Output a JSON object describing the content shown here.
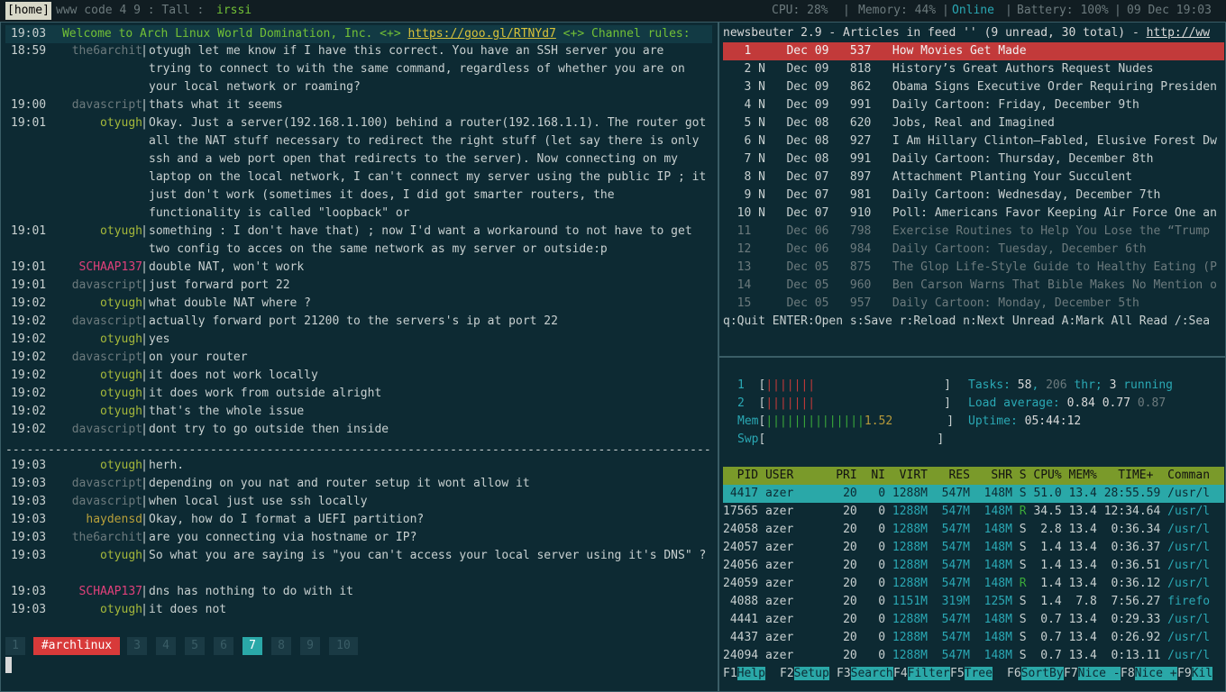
{
  "topbar": {
    "session": "[home]",
    "windows": "www code 4 9 : Tall : ",
    "app": "irssi",
    "cpu_label": "CPU: 28%",
    "mem_label": "Memory: 44%",
    "online": "Online",
    "battery": "Battery: 100%",
    "date": "09 Dec 19:03",
    "sep": "|"
  },
  "irssi": {
    "welcome": {
      "time": "19:03",
      "text": "Welcome to Arch Linux World Domination, Inc. <+> ",
      "link": "https://goo.gl/RTNYd7",
      "tail": " <+> Channel rules:"
    },
    "messages": [
      {
        "time": "18:59",
        "nick": "the6archit",
        "cls": "c-the6",
        "text": "otyugh let me know if I have this correct. You have an SSH server you are trying to connect to with the same command, regardless of whether you are on your local network or roaming?"
      },
      {
        "time": "19:00",
        "nick": "davascript",
        "cls": "c-dav",
        "text": "thats what it seems"
      },
      {
        "time": "19:01",
        "nick": "otyugh",
        "cls": "c-oty",
        "text": "Okay. Just a server(192.168.1.100) behind a router(192.168.1.1). The router got all the NAT stuff necessary to redirect the right stuff (let say there is only ssh and a web port open that redirects to the server). Now connecting on my laptop on the local network, I can't connect my server using the public IP ; it just don't work (sometimes it does, I did got smarter routers, the functionality is called \"loopback\" or"
      },
      {
        "time": "19:01",
        "nick": "otyugh",
        "cls": "c-oty",
        "text": "something : I don't have that) ; now I'd want a workaround to not have to get two config to acces on the same network as my server or outside:p"
      },
      {
        "time": "19:01",
        "nick": "SCHAAP137",
        "cls": "c-sch",
        "text": "double NAT, won't work"
      },
      {
        "time": "19:01",
        "nick": "davascript",
        "cls": "c-dav",
        "text": "just forward port 22"
      },
      {
        "time": "19:02",
        "nick": "otyugh",
        "cls": "c-oty",
        "text": "what double NAT where ?"
      },
      {
        "time": "19:02",
        "nick": "davascript",
        "cls": "c-dav",
        "text": "actually forward port 21200 to the servers's ip at port 22"
      },
      {
        "time": "19:02",
        "nick": "otyugh",
        "cls": "c-oty",
        "text": "yes"
      },
      {
        "time": "19:02",
        "nick": "davascript",
        "cls": "c-dav",
        "text": "on your router"
      },
      {
        "time": "19:02",
        "nick": "otyugh",
        "cls": "c-oty",
        "text": "it does not work locally"
      },
      {
        "time": "19:02",
        "nick": "otyugh",
        "cls": "c-oty",
        "text": "it does work from outside alright"
      },
      {
        "time": "19:02",
        "nick": "otyugh",
        "cls": "c-oty",
        "text": "that's the whole issue"
      },
      {
        "time": "19:02",
        "nick": "davascript",
        "cls": "c-dav",
        "text": "dont try to go outside then inside"
      }
    ],
    "divider": "--------------------------------------------------------------------------------------------------------",
    "messages2": [
      {
        "time": "19:03",
        "nick": "otyugh",
        "cls": "c-oty",
        "text": "herh."
      },
      {
        "time": "19:03",
        "nick": "davascript",
        "cls": "c-dav",
        "text": "depending on you nat and router setup it wont allow it"
      },
      {
        "time": "19:03",
        "nick": "davascript",
        "cls": "c-dav",
        "text": "when local just use ssh locally"
      },
      {
        "time": "19:03",
        "nick": "haydensd",
        "cls": "c-hay",
        "text": "Okay, how do I format a UEFI partition?"
      },
      {
        "time": "19:03",
        "nick": "the6archit",
        "cls": "c-the6",
        "text": "are you connecting via hostname or IP?"
      },
      {
        "time": "19:03",
        "nick": "otyugh",
        "cls": "c-oty",
        "text": "So what you are saying is \"you can't access your local server using it's DNS\" ?"
      },
      {
        "time": "19:03",
        "nick": "SCHAAP137",
        "cls": "c-sch",
        "text": "dns has nothing to do with it"
      },
      {
        "time": "19:03",
        "nick": "otyugh",
        "cls": "c-oty",
        "text": "it does not"
      }
    ],
    "tabs": [
      "1",
      "#archlinux",
      "3",
      "4",
      "5",
      "6",
      "7",
      "8",
      "9",
      "10"
    ]
  },
  "newsbeuter": {
    "title_text": "newsbeuter 2.9 - Articles in feed '' (9 unread, 30 total) - ",
    "title_link": "http://ww",
    "articles": [
      {
        "n": "1",
        "flag": " ",
        "date": "Dec 09",
        "size": "537",
        "title": "How Movies Get Made",
        "state": "sel"
      },
      {
        "n": "2",
        "flag": "N",
        "date": "Dec 09",
        "size": "818",
        "title": "History’s Great Authors Request Nudes",
        "state": "unread"
      },
      {
        "n": "3",
        "flag": "N",
        "date": "Dec 09",
        "size": "862",
        "title": "Obama Signs Executive Order Requiring Presiden",
        "state": "unread"
      },
      {
        "n": "4",
        "flag": "N",
        "date": "Dec 09",
        "size": "991",
        "title": "Daily Cartoon: Friday, December 9th",
        "state": "unread"
      },
      {
        "n": "5",
        "flag": "N",
        "date": "Dec 08",
        "size": "620",
        "title": "Jobs, Real and Imagined",
        "state": "unread"
      },
      {
        "n": "6",
        "flag": "N",
        "date": "Dec 08",
        "size": "927",
        "title": "I Am Hillary Clinton—Fabled, Elusive Forest Dw",
        "state": "unread"
      },
      {
        "n": "7",
        "flag": "N",
        "date": "Dec 08",
        "size": "991",
        "title": "Daily Cartoon: Thursday, December 8th",
        "state": "unread"
      },
      {
        "n": "8",
        "flag": "N",
        "date": "Dec 07",
        "size": "897",
        "title": "Attachment Planting Your Succulent",
        "state": "unread"
      },
      {
        "n": "9",
        "flag": "N",
        "date": "Dec 07",
        "size": "981",
        "title": "Daily Cartoon: Wednesday, December 7th",
        "state": "unread"
      },
      {
        "n": "10",
        "flag": "N",
        "date": "Dec 07",
        "size": "910",
        "title": "Poll: Americans Favor Keeping Air Force One an",
        "state": "unread"
      },
      {
        "n": "11",
        "flag": " ",
        "date": "Dec 06",
        "size": "798",
        "title": "Exercise Routines to Help You Lose the “Trump",
        "state": "read"
      },
      {
        "n": "12",
        "flag": " ",
        "date": "Dec 06",
        "size": "984",
        "title": "Daily Cartoon: Tuesday, December 6th",
        "state": "read"
      },
      {
        "n": "13",
        "flag": " ",
        "date": "Dec 05",
        "size": "875",
        "title": "The Glop Life-Style Guide to Healthy Eating (P",
        "state": "read"
      },
      {
        "n": "14",
        "flag": " ",
        "date": "Dec 05",
        "size": "960",
        "title": "Ben Carson Warns That Bible Makes No Mention o",
        "state": "read"
      },
      {
        "n": "15",
        "flag": " ",
        "date": "Dec 05",
        "size": "957",
        "title": "Daily Cartoon: Monday, December 5th",
        "state": "read"
      }
    ],
    "help": "q:Quit ENTER:Open s:Save r:Reload n:Next Unread A:Mark All Read /:Sea"
  },
  "htop": {
    "cpu1_label": "1",
    "cpu1_bar": "|||||||",
    "cpu2_label": "2",
    "cpu2_bar": "|||||||",
    "mem_label": "Mem",
    "mem_bar": "||||||||||||||",
    "mem_value": "1.52",
    "swp_label": "Swp",
    "tasks_label": "Tasks: ",
    "tasks": "58",
    "thr": "206",
    "thr_label": " thr; ",
    "running": "3",
    "running_label": " running",
    "load_label": "Load average: ",
    "load1": "0.84",
    "load5": "0.77",
    "load15": "0.87",
    "uptime_label": "Uptime: ",
    "uptime": "05:44:12",
    "header": "  PID USER      PRI  NI  VIRT   RES   SHR S CPU% MEM%   TIME+  Comman",
    "processes": [
      {
        "pid": "4417",
        "user": "azer",
        "pri": "20",
        "ni": "0",
        "virt": "1288M",
        "res": "547M",
        "shr": "148M",
        "s": "S",
        "cpu": "51.0",
        "mem": "13.4",
        "time": "28:55.59",
        "cmd": "/usr/l"
      },
      {
        "pid": "17565",
        "user": "azer",
        "pri": "20",
        "ni": "0",
        "virt": "1288M",
        "res": "547M",
        "shr": "148M",
        "s": "R",
        "cpu": "34.5",
        "mem": "13.4",
        "time": "12:34.64",
        "cmd": "/usr/l"
      },
      {
        "pid": "24058",
        "user": "azer",
        "pri": "20",
        "ni": "0",
        "virt": "1288M",
        "res": "547M",
        "shr": "148M",
        "s": "S",
        "cpu": "2.8",
        "mem": "13.4",
        "time": "0:36.34",
        "cmd": "/usr/l"
      },
      {
        "pid": "24057",
        "user": "azer",
        "pri": "20",
        "ni": "0",
        "virt": "1288M",
        "res": "547M",
        "shr": "148M",
        "s": "S",
        "cpu": "1.4",
        "mem": "13.4",
        "time": "0:36.37",
        "cmd": "/usr/l"
      },
      {
        "pid": "24056",
        "user": "azer",
        "pri": "20",
        "ni": "0",
        "virt": "1288M",
        "res": "547M",
        "shr": "148M",
        "s": "S",
        "cpu": "1.4",
        "mem": "13.4",
        "time": "0:36.51",
        "cmd": "/usr/l"
      },
      {
        "pid": "24059",
        "user": "azer",
        "pri": "20",
        "ni": "0",
        "virt": "1288M",
        "res": "547M",
        "shr": "148M",
        "s": "R",
        "cpu": "1.4",
        "mem": "13.4",
        "time": "0:36.12",
        "cmd": "/usr/l"
      },
      {
        "pid": "4088",
        "user": "azer",
        "pri": "20",
        "ni": "0",
        "virt": "1151M",
        "res": "319M",
        "shr": "125M",
        "s": "S",
        "cpu": "1.4",
        "mem": "7.8",
        "time": "7:56.27",
        "cmd": "firefo"
      },
      {
        "pid": "4441",
        "user": "azer",
        "pri": "20",
        "ni": "0",
        "virt": "1288M",
        "res": "547M",
        "shr": "148M",
        "s": "S",
        "cpu": "0.7",
        "mem": "13.4",
        "time": "0:29.33",
        "cmd": "/usr/l"
      },
      {
        "pid": "4437",
        "user": "azer",
        "pri": "20",
        "ni": "0",
        "virt": "1288M",
        "res": "547M",
        "shr": "148M",
        "s": "S",
        "cpu": "0.7",
        "mem": "13.4",
        "time": "0:26.92",
        "cmd": "/usr/l"
      },
      {
        "pid": "24094",
        "user": "azer",
        "pri": "20",
        "ni": "0",
        "virt": "1288M",
        "res": "547M",
        "shr": "148M",
        "s": "S",
        "cpu": "0.7",
        "mem": "13.4",
        "time": "0:13.11",
        "cmd": "/usr/l"
      }
    ],
    "fkeys": [
      {
        "k": "F1",
        "label": "Help  "
      },
      {
        "k": "F2",
        "label": "Setup "
      },
      {
        "k": "F3",
        "label": "Search"
      },
      {
        "k": "F4",
        "label": "Filter"
      },
      {
        "k": "F5",
        "label": "Tree  "
      },
      {
        "k": "F6",
        "label": "SortBy"
      },
      {
        "k": "F7",
        "label": "Nice -"
      },
      {
        "k": "F8",
        "label": "Nice +"
      },
      {
        "k": "F9",
        "label": "Kil"
      }
    ]
  }
}
